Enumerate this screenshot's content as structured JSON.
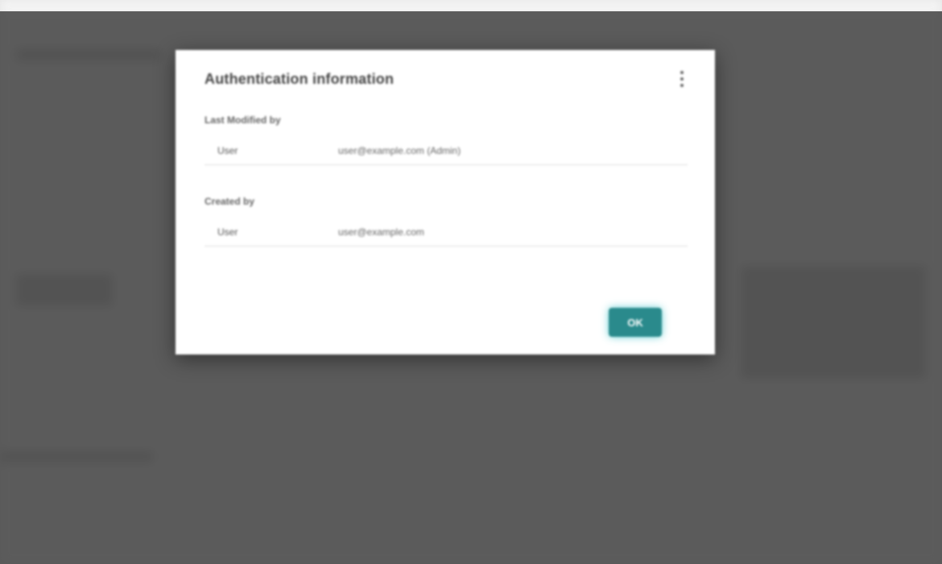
{
  "dialog": {
    "title": "Authentication information",
    "sections": [
      {
        "label": "Last Modified by",
        "key": "User",
        "value": "user@example.com (Admin)"
      },
      {
        "label": "Created by",
        "key": "User",
        "value": "user@example.com"
      }
    ],
    "ok_label": "OK"
  },
  "colors": {
    "overlay": "#3a3a3a",
    "dialog_background": "#ffffff",
    "accent": "#2a8a8c"
  }
}
